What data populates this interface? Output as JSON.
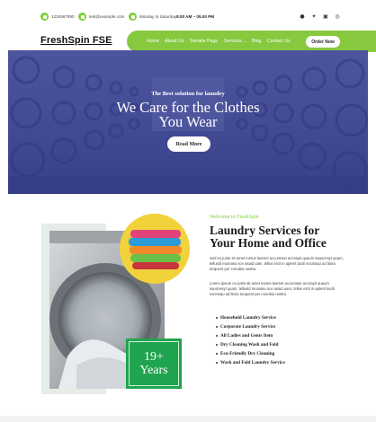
{
  "topbar": {
    "phone": "1234567890",
    "email": "test@example.com",
    "hours_prefix": "Monday to Saturday ",
    "hours_time": "8.00 AM – 05.00 PM",
    "social_icons": [
      "facebook-icon",
      "twitter-icon",
      "linkedin-icon",
      "instagram-icon"
    ]
  },
  "header": {
    "brand": "FreshSpin FSE",
    "nav": [
      "Home",
      "About Us",
      "Sample Page",
      "Services ⌄",
      "Blog",
      "Contact Us"
    ],
    "order_button": "Order Now"
  },
  "hero": {
    "subtitle": "The Best solution for laundry",
    "title_line1": "We Care for the Clothes",
    "title_line2": "You Wear",
    "button": "Read More"
  },
  "about": {
    "welcome": "Welcome to FreshSpin",
    "title_line1": "Laundry Services for",
    "title_line2": "Your Home and Office",
    "paragraph1": "Sed eu justo sit amet metus laoreet accumsan accsayit quaum sauscesyt quam, tellusid mumasu sce asaid uam, tellus eicit in aptent taciti sociosqu ad litora torquent per conubia nostra",
    "paragraph2": "Lorem ipsum eu justo sit amet metus laoreet accumsan accsayit quaum sauscesyt quam, tellusid mumasu sce asaid uam, tellus eicit in aptent taciti sociosqu ad litora torquent per conubia nostra",
    "services": [
      "Household Laundry Service",
      "Corporate Laundry Service",
      "All Ladies and Gents Item",
      "Dry Cleaning Wash and Fold",
      "Eco-Friendly Dry Cleaning",
      "Wash and Fold Laundry Service"
    ],
    "years_number": "19+",
    "years_label": "Years"
  },
  "colors": {
    "accent_green": "#86c93f",
    "badge_green": "#1fa54f",
    "hero_overlay": "#4a5299"
  }
}
